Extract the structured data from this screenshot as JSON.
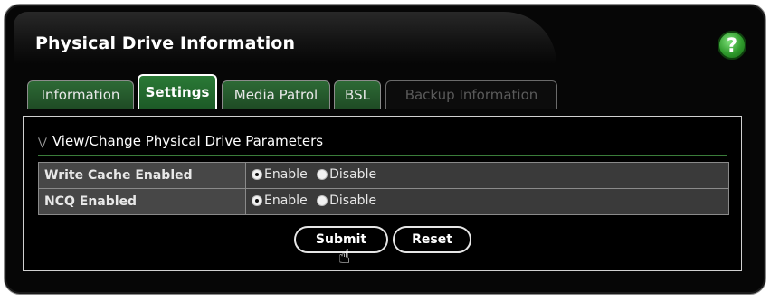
{
  "window": {
    "title": "Physical Drive Information",
    "help_label": "?"
  },
  "tabs": [
    {
      "label": "Information",
      "state": "normal"
    },
    {
      "label": "Settings",
      "state": "active"
    },
    {
      "label": "Media Patrol",
      "state": "normal"
    },
    {
      "label": "BSL",
      "state": "normal"
    },
    {
      "label": "Backup Information",
      "state": "disabled"
    }
  ],
  "section": {
    "title": "View/Change Physical Drive Parameters"
  },
  "parameters": [
    {
      "label": "Write Cache Enabled",
      "options": [
        "Enable",
        "Disable"
      ],
      "selected": "Enable"
    },
    {
      "label": "NCQ Enabled",
      "options": [
        "Enable",
        "Disable"
      ],
      "selected": "Enable"
    }
  ],
  "buttons": {
    "submit": "Submit",
    "reset": "Reset"
  },
  "colors": {
    "window_bg": "#060606",
    "tab_green": "#1f4c25",
    "help_green": "#2f9a2c"
  }
}
